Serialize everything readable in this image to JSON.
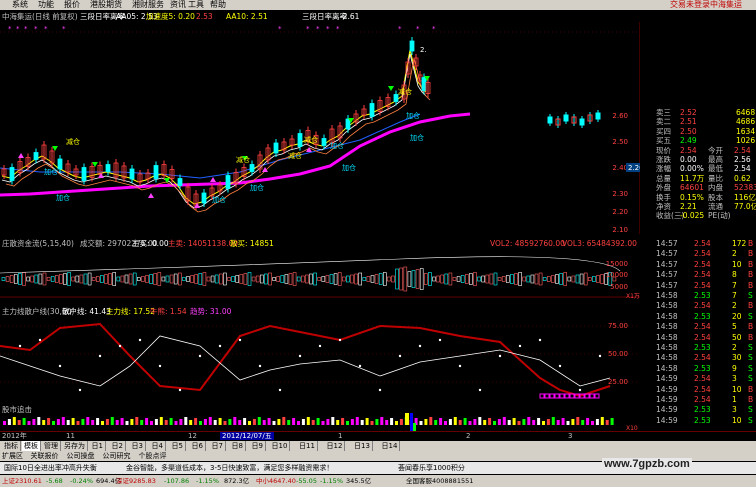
{
  "menu": {
    "items": [
      "系统",
      "功能",
      "报价",
      "港股期货",
      "湘财服务",
      "资讯",
      "工具",
      "帮助"
    ],
    "login": "交易未登录",
    "broker": "中海集运"
  },
  "main_header": {
    "title": "中海集运(日线 前复权)",
    "ind1_name": "三段日率离率",
    "ind1_ma5": "AA05: 2.53",
    "ind1_acc": "加速度5: 0.20",
    "ind1_v": "2.53",
    "aa10": "AA10: 2.51",
    "ind2_name": "三段日率离率",
    "ind2_val": "-2.61"
  },
  "main_chart": {
    "price_ticks": [
      "2.60",
      "2.50",
      "2.40",
      "2.30",
      "2.20",
      "2.10"
    ],
    "current_price_tag": "2.26",
    "labels": [
      {
        "text": "加仓",
        "color": "#00e0ff"
      },
      {
        "text": "减仓",
        "color": "#ffff00"
      },
      {
        "text": "加仓",
        "color": "#00e0ff"
      },
      {
        "text": "减仓",
        "color": "#ffff00"
      },
      {
        "text": "加仓",
        "color": "#00e0ff"
      },
      {
        "text": "减仓",
        "color": "#ffff00"
      },
      {
        "text": "加仓",
        "color": "#00e0ff"
      },
      {
        "text": "加仓",
        "color": "#00e0ff"
      },
      {
        "text": "减仓",
        "color": "#ffff00"
      },
      {
        "text": "加仓",
        "color": "#00e0ff"
      },
      {
        "text": "加仓",
        "color": "#00e0ff"
      },
      {
        "text": "减仓",
        "color": "#ffff00"
      },
      {
        "text": "加仓",
        "color": "#00e0ff"
      },
      {
        "text": "2.",
        "color": "#ffffff"
      }
    ]
  },
  "vol_header": {
    "title": "庄散资金流(5,15,40)",
    "amount": "成交额: 29702276.00",
    "main": "主买: 0.00",
    "main2": "主卖: 14051138.00",
    "retail": "散买: 14851",
    "vol2": "VOL2: 48592760.00",
    "vol3": "VOL3: 65484392.00"
  },
  "vol_chart": {
    "ticks": [
      "15000",
      "10000",
      "5000"
    ],
    "unit": "X1万"
  },
  "fund_header": {
    "title": "主力线散户线(30,60)",
    "retail": "散户线: 41.43",
    "main": "主力线: 17.52",
    "bull": "牛熊: 1.54",
    "dash": "趋势: 31.00"
  },
  "fund_chart": {
    "ticks": [
      "75.00",
      "50.00",
      "25.00"
    ]
  },
  "sig_header": {
    "title": "股市追击"
  },
  "sig_chart": {
    "unit": "X10"
  },
  "quote": {
    "rows": [
      {
        "label": "卖三",
        "price": "2.52",
        "vol": "6468",
        "color": "#ff4040"
      },
      {
        "label": "卖二",
        "price": "2.51",
        "vol": "4686",
        "color": "#ff4040"
      },
      {
        "label": "买四",
        "price": "2.50",
        "vol": "1634",
        "color": "#ff4040"
      },
      {
        "label": "买五",
        "price": "2.49",
        "vol": "1026",
        "color": "#00ff00"
      },
      {
        "label": "现价",
        "price": "2.54",
        "k": "今开",
        "v": "2.54",
        "color": "#ff4040"
      },
      {
        "label": "涨跌",
        "price": "0.00",
        "k": "最高",
        "v": "2.56",
        "color": "#ffffff"
      },
      {
        "label": "涨幅",
        "price": "0.00%",
        "k": "最低",
        "v": "2.54",
        "color": "#ffffff"
      },
      {
        "label": "总量",
        "price": "11.7万",
        "k": "量比",
        "v": "0.62",
        "color": "#ffff00"
      },
      {
        "label": "外盘",
        "price": "64601",
        "k": "内盘",
        "v": "52383",
        "color": "#ff4040"
      },
      {
        "label": "换手",
        "price": "0.15%",
        "k": "股本",
        "v": "116亿",
        "color": "#ffff00"
      },
      {
        "label": "净资",
        "price": "2.21",
        "k": "流通",
        "v": "77.0亿",
        "color": "#ffff00"
      },
      {
        "label": "收益(三)",
        "price": "-0.025",
        "k": "PE(动)",
        "v": "",
        "color": "#ffff00"
      }
    ]
  },
  "ticks": [
    {
      "time": "14:57",
      "price": "2.54",
      "vol": "172",
      "dir": "B"
    },
    {
      "time": "14:57",
      "price": "2.54",
      "vol": "2",
      "dir": "B"
    },
    {
      "time": "14:57",
      "price": "2.54",
      "vol": "10",
      "dir": "B"
    },
    {
      "time": "14:57",
      "price": "2.54",
      "vol": "8",
      "dir": "B"
    },
    {
      "time": "14:57",
      "price": "2.54",
      "vol": "7",
      "dir": "B"
    },
    {
      "time": "14:58",
      "price": "2.53",
      "vol": "7",
      "dir": "S"
    },
    {
      "time": "14:58",
      "price": "2.54",
      "vol": "2",
      "dir": "B"
    },
    {
      "time": "14:58",
      "price": "2.53",
      "vol": "20",
      "dir": "S"
    },
    {
      "time": "14:58",
      "price": "2.54",
      "vol": "5",
      "dir": "B"
    },
    {
      "time": "14:58",
      "price": "2.54",
      "vol": "50",
      "dir": "B"
    },
    {
      "time": "14:58",
      "price": "2.53",
      "vol": "2",
      "dir": "S"
    },
    {
      "time": "14:58",
      "price": "2.54",
      "vol": "30",
      "dir": "S"
    },
    {
      "time": "14:58",
      "price": "2.53",
      "vol": "9",
      "dir": "S"
    },
    {
      "time": "14:59",
      "price": "2.54",
      "vol": "3",
      "dir": "S"
    },
    {
      "time": "14:59",
      "price": "2.54",
      "vol": "10",
      "dir": "B"
    },
    {
      "time": "14:59",
      "price": "2.54",
      "vol": "1",
      "dir": "B"
    },
    {
      "time": "14:59",
      "price": "2.53",
      "vol": "3",
      "dir": "S"
    },
    {
      "time": "14:59",
      "price": "2.53",
      "vol": "10",
      "dir": "S"
    }
  ],
  "datebar": {
    "y2012": "2012年",
    "m11": "11",
    "m12": "12",
    "cursor": "2012/12/07/五",
    "m1": "1",
    "m2": "2",
    "m3": "3"
  },
  "tabs": [
    "指标",
    "模板",
    "管理",
    "另存为",
    "日1",
    "日2",
    "日3",
    "日4",
    "日5",
    "日6",
    "日7",
    "日8",
    "日9",
    "日10",
    "日11",
    "日12",
    "日13",
    "日14"
  ],
  "subtabs": [
    "扩展区",
    "关联报价",
    "公司操盘",
    "公司研究",
    "个股点评"
  ],
  "news": [
    {
      "text": "国际10日全进出率冲高升失衡",
      "color": "#000"
    },
    {
      "text": "金谷智能，多渠道低成本，3-5日快速致富，满足您多样融资需求！",
      "color": "#000"
    },
    {
      "text": "荟闻春乐享1000积分",
      "color": "#000"
    }
  ],
  "watermark": "www.7gpzb.com",
  "status": [
    {
      "text": "上证2310.61",
      "color": "#c00000"
    },
    {
      "text": "-5.68",
      "color": "#008000"
    },
    {
      "text": "-0.24%",
      "color": "#008000"
    },
    {
      "text": "694.4亿",
      "color": "#000"
    },
    {
      "text": "深证9285.83",
      "color": "#c00000"
    },
    {
      "text": "-107.86",
      "color": "#008000"
    },
    {
      "text": "-1.15%",
      "color": "#008000"
    },
    {
      "text": "872.3亿",
      "color": "#000"
    },
    {
      "text": "中小4647.40",
      "color": "#c00000"
    },
    {
      "text": "-55.05",
      "color": "#008000"
    },
    {
      "text": "-1.15%",
      "color": "#008000"
    },
    {
      "text": "345.5亿",
      "color": "#000"
    },
    {
      "text": "全国客服4008881551",
      "color": "#000"
    }
  ]
}
